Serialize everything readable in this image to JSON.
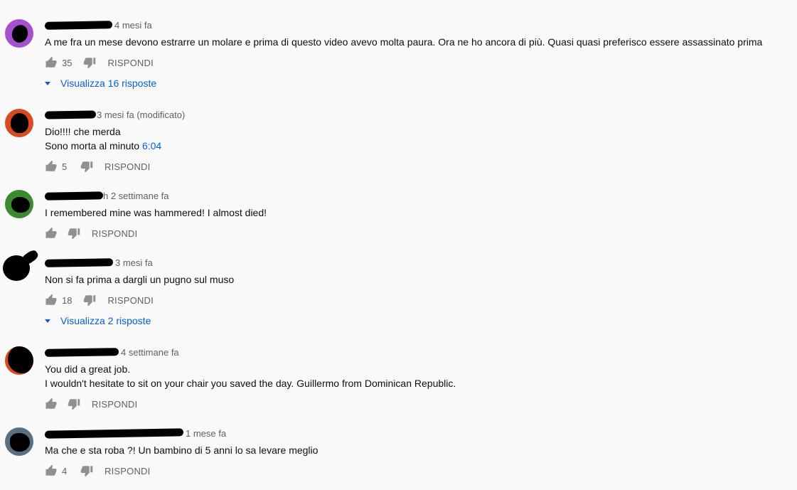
{
  "comments": [
    {
      "time": "4 mesi fa",
      "text_lines": [
        "A me fra un mese devono estrarre un molare e prima di questo video avevo molta paura. Ora ne ho ancora di più. Quasi quasi preferisco essere assassinato prima"
      ],
      "likes": "35",
      "reply_label": "RISPONDI",
      "view_replies": "Visualizza 16 risposte",
      "avatar_color": "#a64fd1"
    },
    {
      "time": "3 mesi fa (modificato)",
      "text_lines": [
        "Dio!!!! che merda"
      ],
      "text_line2_prefix": "Sono morta al minuto ",
      "text_line2_link": "6:04",
      "likes": "5",
      "reply_label": "RISPONDI",
      "avatar_color": "#d84a1f"
    },
    {
      "time": "h 2 settimane fa",
      "text_lines": [
        "I remembered mine was hammered! I almost died!"
      ],
      "likes": "",
      "reply_label": "RISPONDI",
      "avatar_color": "#3a8a2e"
    },
    {
      "time": "3 mesi fa",
      "text_lines": [
        "Non si fa prima a dargli un pugno sul muso"
      ],
      "likes": "18",
      "reply_label": "RISPONDI",
      "view_replies": "Visualizza 2 risposte",
      "avatar_color": "#000000"
    },
    {
      "time": "4 settimane fa",
      "text_lines": [
        "You did a great job.",
        "I wouldn't hesitate to sit on your chair you saved the day. Guillermo from Dominican Republic."
      ],
      "likes": "",
      "reply_label": "RISPONDI",
      "avatar_color": "#d84a1f"
    },
    {
      "time": "1 mese fa",
      "text_lines": [
        "Ma che e sta roba  ?! Un bambino di 5 anni lo sa levare meglio"
      ],
      "likes": "4",
      "reply_label": "RISPONDI",
      "avatar_color": "#5a6f82"
    }
  ],
  "icons": {
    "like": "thumb-up-icon",
    "dislike": "thumb-down-icon",
    "expand": "caret-down-icon"
  },
  "colors": {
    "link": "#065fd4",
    "meta": "#606060",
    "background": "#f9f9f9"
  }
}
